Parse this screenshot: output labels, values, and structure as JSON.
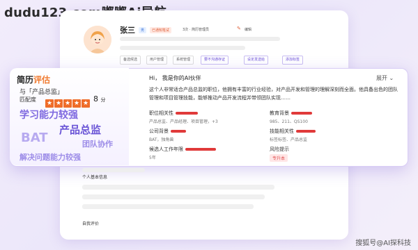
{
  "watermark": "dudu123.com嘟嘟Ai导航",
  "credit": "搜狐号@AI探科技",
  "profile": {
    "name": "张三",
    "badge_blue": "男",
    "badge_red": "已通知笔试",
    "status": "3次 · 简历管理员",
    "edit": "编辑"
  },
  "chips": [
    "备选候选",
    "用户管理",
    "系统管理",
    "要不沟通存证",
    "设定发送给",
    "添加标签"
  ],
  "resume": {
    "title_black": "简历",
    "title_orange": "评估",
    "for_line": "与「产品总监」",
    "match_label": "匹配度",
    "stars": 5,
    "score": "8",
    "score_unit": "分",
    "tags": [
      "学习能力较强",
      "产品总监",
      "BAT",
      "团队协作",
      "解决问题能力较强"
    ]
  },
  "assistant": {
    "greeting": "Hi， 我是你的AI伙伴",
    "expand": "展开",
    "summary": "这个人非常适合产品总监的职位，他拥有丰富的行业经验，对产品开发和管理的理解深刻而全面。他具备出色的团队管理和项目管理技能，能够推动产品开发流程并带领团队实现……",
    "fields": [
      {
        "label": "职位相关性",
        "value": "产品总监、产品经理、项目管理，+3"
      },
      {
        "label": "教育背景",
        "value": "985、211、QS100"
      },
      {
        "label": "公司背景",
        "value": "BAT，独角兽"
      },
      {
        "label": "技能相关性",
        "value": "标签标签、产品总监"
      },
      {
        "label": "候选人工作年限",
        "value": "5年"
      },
      {
        "label": "风险提示",
        "value": "专升本"
      }
    ]
  },
  "sections": {
    "basic_info": "个人基本信息",
    "self_eval": "自我评价"
  },
  "colors": {
    "accent": "#ef6d2a",
    "brand_purple": "#6b4fd8",
    "bar_red": "#e03a3a"
  }
}
